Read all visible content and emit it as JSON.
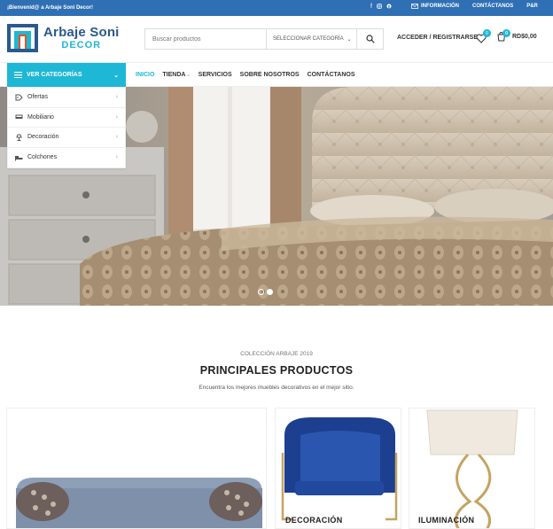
{
  "topbar": {
    "welcome": "¡Bienvenid@ a Arbaje Soni Decor!",
    "social_icons": [
      "facebook-icon",
      "instagram-icon",
      "pinterest-icon"
    ],
    "info_label": "INFORMACIÓN",
    "contact_label": "CONTÁCTANOS",
    "extra_label": "P&R"
  },
  "header": {
    "logo_line1": "Arbaje Soni",
    "logo_line2": "DECOR",
    "search_placeholder": "Buscar productos",
    "category_select": "SELECCIONAR CATEGORÍA",
    "account_label": "ACCEDER / REGISTRARSE",
    "wishlist_count": "0",
    "cart_count": "0",
    "cart_total": "RD$0,00"
  },
  "nav": {
    "categories_button": "VER CATEGORÍAS",
    "items": [
      "INICIO",
      "TIENDA",
      "SERVICIOS",
      "SOBRE NOSOTROS",
      "CONTÁCTANOS"
    ]
  },
  "category_menu": [
    {
      "label": "Ofertas",
      "icon": "tag-icon"
    },
    {
      "label": "Mobiliario",
      "icon": "sofa-icon"
    },
    {
      "label": "Decoración",
      "icon": "lamp-icon"
    },
    {
      "label": "Colchones",
      "icon": "bed-icon"
    }
  ],
  "slider": {
    "dots": 2,
    "active": 0
  },
  "section": {
    "kicker": "COLECCIÓN ARBAJE 2019",
    "title": "PRINCIPALES PRODUCTOS",
    "subtitle": "Encuentra los mejores muebles decorativos en el mejor sitio."
  },
  "cards": [
    {
      "label": ""
    },
    {
      "label": "DECORACIÓN"
    },
    {
      "label": "ILUMINACIÓN"
    }
  ],
  "colors": {
    "topbar": "#2f6fb4",
    "accent": "#1fb7d6",
    "logo_blue": "#2a5a8c"
  }
}
